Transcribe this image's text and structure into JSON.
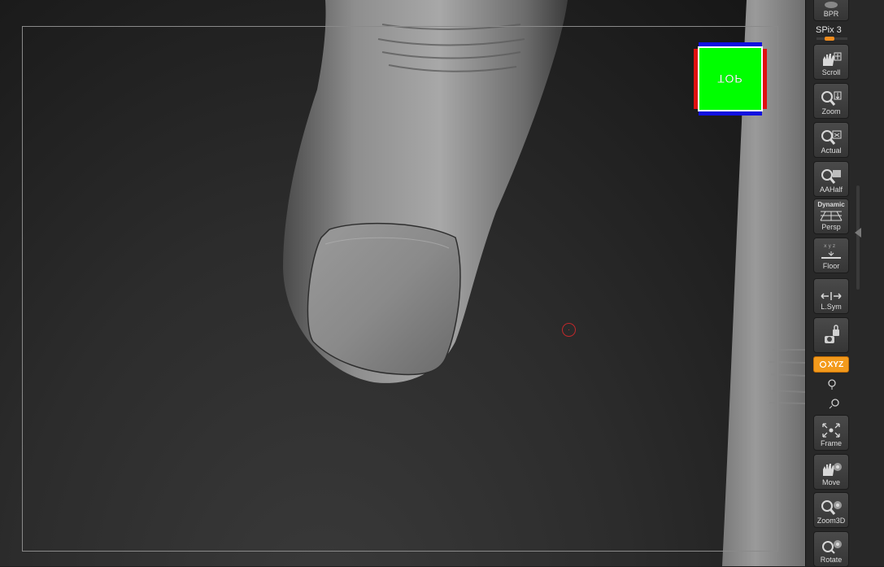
{
  "viewport": {
    "nav_cube_label": "TOP",
    "nav_cube_colors": {
      "face": "#00ff00",
      "x_axis": "#e01010",
      "z_axis": "#1010e0"
    },
    "cursor_color": "#c0282a"
  },
  "shelf": {
    "bpr": {
      "label": "BPR",
      "icon": "bpr-render-icon"
    },
    "spix_label": "SPix 3",
    "buttons": [
      {
        "label": "Scroll",
        "icon": "hand-scroll-icon"
      },
      {
        "label": "Zoom",
        "icon": "zoom-magnifier-icon"
      },
      {
        "label": "Actual",
        "icon": "actual-size-icon"
      },
      {
        "label": "AAHalf",
        "icon": "aahalf-icon"
      },
      {
        "label": "Persp",
        "icon": "perspective-grid-icon",
        "sublabel": "Dynamic"
      },
      {
        "label": "Floor",
        "icon": "floor-grid-icon"
      },
      {
        "label": "L.Sym",
        "icon": "local-symmetry-icon"
      },
      {
        "label": "",
        "icon": "camera-lock-icon"
      },
      {
        "label": "Frame",
        "icon": "frame-icon"
      },
      {
        "label": "Move",
        "icon": "hand-move-icon"
      },
      {
        "label": "Zoom3D",
        "icon": "zoom3d-icon"
      },
      {
        "label": "Rotate",
        "icon": "rotate-icon"
      }
    ],
    "xyz_label": "XYZ",
    "accent_color": "#f39a1c"
  }
}
